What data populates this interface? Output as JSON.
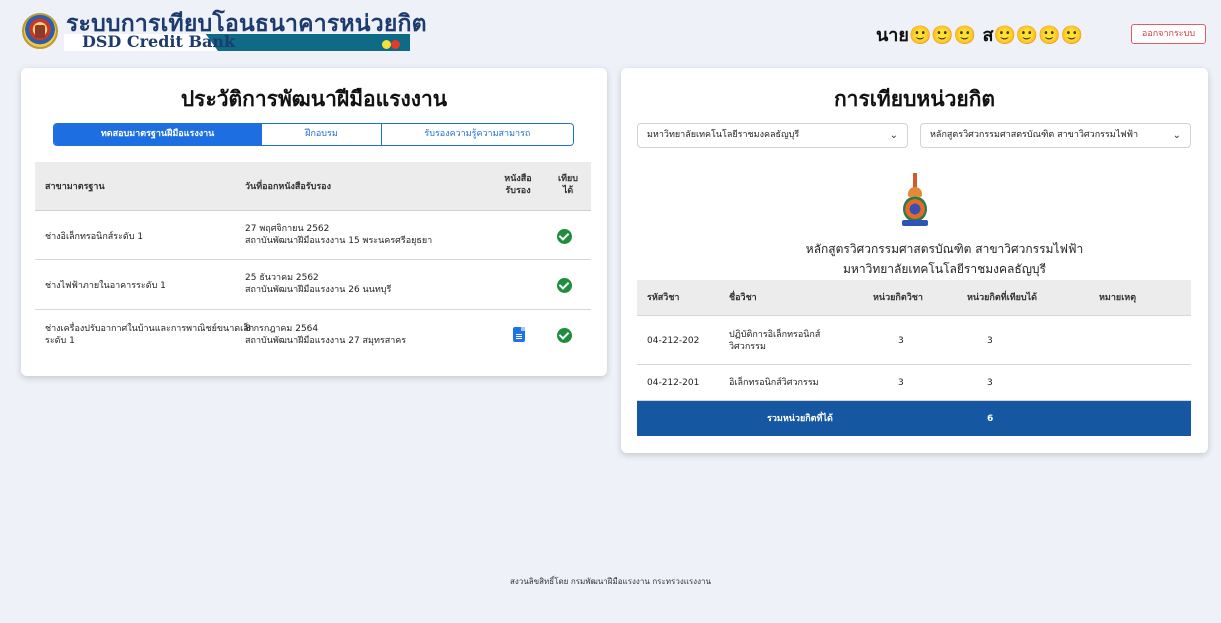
{
  "header": {
    "brand_thai": "ระบบการเทียบโอนธนาคารหน่วยกิต",
    "brand_en": "DSD Credit Bank",
    "user_name": "นาย🙂🙂🙂 ส🙂🙂🙂🙂",
    "logout_label": "ออกจากระบบ"
  },
  "left": {
    "title": "ประวัติการพัฒนาฝีมือแรงงาน",
    "tabs": [
      {
        "label": "ทดสอบมาตรฐานฝีมือแรงงาน",
        "active": true
      },
      {
        "label": "ฝึกอบรม",
        "active": false
      },
      {
        "label": "รับรองความรู้ความสามารถ",
        "active": false
      }
    ],
    "columns": {
      "standard": "สาขามาตรฐาน",
      "issue_date": "วันที่ออกหนังสือรับรอง",
      "certificate_1": "หนังสือ",
      "certificate_2": "รับรอง",
      "transfer_1": "เทียบ",
      "transfer_2": "ได้"
    },
    "rows": [
      {
        "standard_1": "ช่างอิเล็กทรอนิกส์ระดับ 1",
        "standard_2": "",
        "date": "27 พฤศจิกายน 2562",
        "institute": "สถาบันพัฒนาฝีมือแรงงาน 15 พระนครศรีอยุธยา",
        "has_doc": false,
        "transferable": true
      },
      {
        "standard_1": "ช่างไฟฟ้าภายในอาคารระดับ 1",
        "standard_2": "",
        "date": "25 ธันวาคม 2562",
        "institute": "สถาบันพัฒนาฝีมือแรงงาน 26 นนทบุรี",
        "has_doc": false,
        "transferable": true
      },
      {
        "standard_1": "ช่างเครื่องปรับอากาศในบ้านและการพาณิชย์ขนาดเล็ก",
        "standard_2": "ระดับ 1",
        "date": "8 กรกฎาคม 2564",
        "institute": "สถาบันพัฒนาฝีมือแรงงาน 27 สมุทรสาคร",
        "has_doc": true,
        "transferable": true
      }
    ]
  },
  "right": {
    "title": "การเทียบหน่วยกิต",
    "university_select": "มหาวิทยาลัยเทคโนโลยีราชมงคลธัญบุรี",
    "program_select": "หลักสูตรวิศวกรรมศาสตรบัณฑิต สาขาวิศวกรรมไฟฟ้า",
    "program_name": "หลักสูตรวิศวกรรมศาสตรบัณฑิต สาขาวิศวกรรมไฟฟ้า",
    "university_name": "มหาวิทยาลัยเทคโนโลยีราชมงคลธัญบุรี",
    "columns": {
      "code": "รหัสวิชา",
      "name": "ชื่อวิชา",
      "credits": "หน่วยกิตวิชา",
      "transferred": "หน่วยกิตที่เทียบได้",
      "note": "หมายเหตุ"
    },
    "rows": [
      {
        "code": "04-212-202",
        "name_1": "ปฏิบัติการอิเล็กทรอนิกส์",
        "name_2": "วิศวกรรม",
        "credits": "3",
        "transferred": "3",
        "note": ""
      },
      {
        "code": "04-212-201",
        "name_1": "อิเล็กทรอนิกส์วิศวกรรม",
        "name_2": "",
        "credits": "3",
        "transferred": "3",
        "note": ""
      }
    ],
    "total_label": "รวมหน่วยกิตที่ได้",
    "total_value": "6"
  },
  "footer": "สงวนลิขสิทธิ์โดย กรมพัฒนาฝีมือแรงงาน กระทรวงแรงงาน",
  "colors": {
    "primary": "#1d6ee0",
    "total_bar": "#1557a0",
    "check": "#1e8e3e",
    "logout": "#d23c47",
    "page_bg": "#eef2f8"
  }
}
